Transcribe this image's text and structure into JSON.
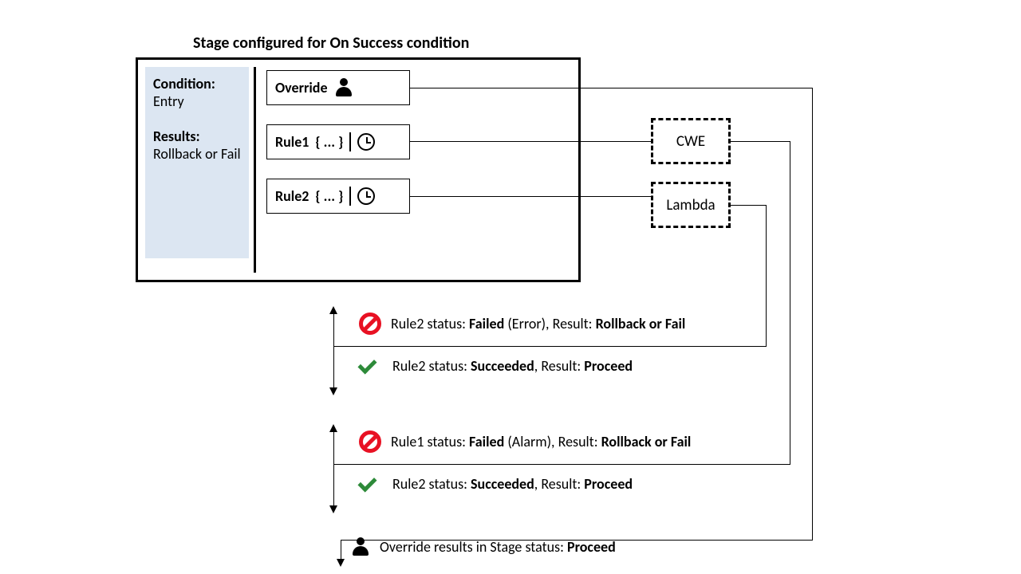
{
  "title": "Stage configured for On Success condition",
  "condition": {
    "heading1": "Condition:",
    "value1": "Entry",
    "heading2": "Results:",
    "value2": "Rollback or Fail"
  },
  "boxes": {
    "override": "Override",
    "rule1_label": "Rule1",
    "rule1_body": "{ ... }",
    "rule2_label": "Rule2",
    "rule2_body": "{ ... }"
  },
  "targets": {
    "cwe": "CWE",
    "lambda": "Lambda"
  },
  "outcomes": {
    "r2_fail_pre": "Rule2 status: ",
    "r2_fail_status": "Failed",
    "r2_fail_mid": " (Error), Result: ",
    "r2_fail_result": "Rollback or Fail",
    "r2_succ_pre": "Rule2 status: ",
    "r2_succ_status": "Succeeded",
    "r2_succ_mid": ", Result: ",
    "r2_succ_result": "Proceed",
    "r1_fail_pre": "Rule1 status: ",
    "r1_fail_status": "Failed",
    "r1_fail_mid": " (Alarm), Result: ",
    "r1_fail_result": "Rollback or Fail",
    "r2b_succ_pre": "Rule2 status: ",
    "r2b_succ_status": "Succeeded",
    "r2b_succ_mid": ", Result: ",
    "r2b_succ_result": "Proceed",
    "override_text_pre": "Override results in Stage status: ",
    "override_result": "Proceed"
  }
}
